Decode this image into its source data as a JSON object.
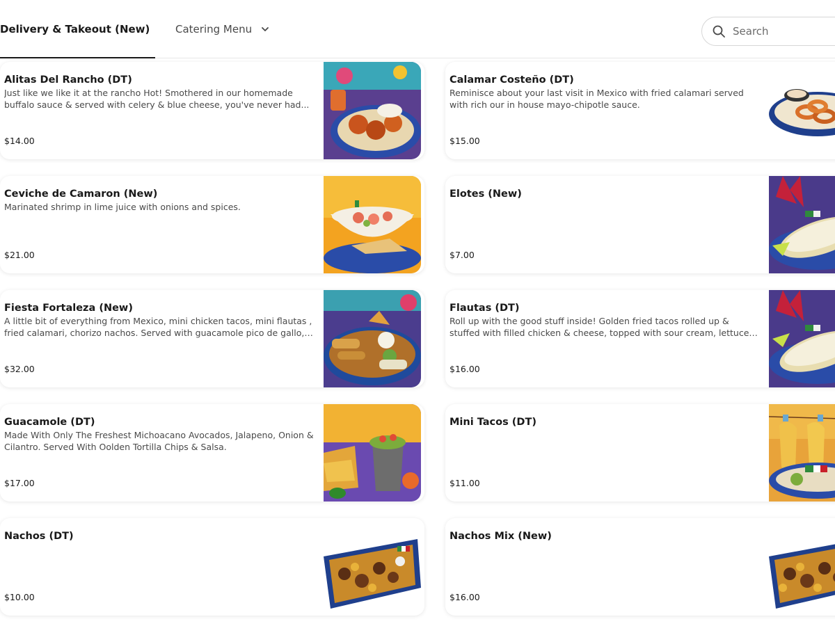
{
  "tabs": [
    {
      "label": "Delivery & Takeout (New)",
      "active": true
    },
    {
      "label": "Catering Menu",
      "active": false
    }
  ],
  "search": {
    "placeholder": "Search",
    "icon": "search-icon"
  },
  "items": [
    {
      "name": "Alitas Del Rancho (DT)",
      "description": "Just like we like it at the rancho Hot! Smothered in our homemade buffalo sauce & served with celery & blue cheese, you've never had...",
      "price": "$14.00"
    },
    {
      "name": "Calamar Costeño (DT)",
      "description": "Reminisce about your last visit in Mexico with fried calamari served with rich our in house mayo-chipotle sauce.",
      "price": "$15.00"
    },
    {
      "name": "Ceviche de Camaron (New)",
      "description": "Marinated shrimp in lime juice with onions and spices.",
      "price": "$21.00"
    },
    {
      "name": "Elotes (New)",
      "description": "",
      "price": "$7.00"
    },
    {
      "name": "Fiesta Fortaleza (New)",
      "description": "A little bit of everything from Mexico, mini chicken tacos, mini flautas , fried calamari, chorizo nachos. Served with guacamole pico de gallo, &...",
      "price": "$32.00"
    },
    {
      "name": "Flautas (DT)",
      "description": "Roll up with the good stuff inside! Golden fried tacos rolled up & stuffed with filled chicken & cheese, topped with sour cream, lettuce & our...",
      "price": "$16.00"
    },
    {
      "name": "Guacamole (DT)",
      "description": "Made With Only The Freshest Michoacano Avocados, Jalapeno, Onion & Cilantro. Served With Oolden Tortilla Chips & Salsa.",
      "price": "$17.00"
    },
    {
      "name": "Mini Tacos (DT)",
      "description": "",
      "price": "$11.00"
    },
    {
      "name": "Nachos (DT)",
      "description": "",
      "price": "$10.00"
    },
    {
      "name": "Nachos Mix (New)",
      "description": "",
      "price": "$16.00"
    }
  ],
  "colors": {
    "accent": "#191919",
    "muted_text": "#494949",
    "divider": "#e7e7e7"
  }
}
